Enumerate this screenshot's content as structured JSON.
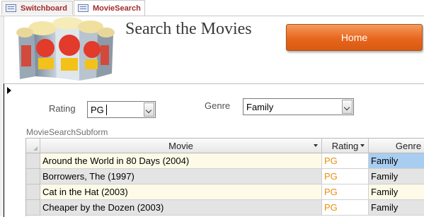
{
  "tabs": [
    {
      "label": "Switchboard",
      "active": false
    },
    {
      "label": "MovieSearch",
      "active": true
    }
  ],
  "form": {
    "title": "Search the Movies",
    "home_button": "Home",
    "rating_label": "Rating",
    "rating_value": "PG",
    "genre_label": "Genre",
    "genre_value": "Family",
    "subform_label": "MovieSearchSubform"
  },
  "table": {
    "columns": [
      "Movie",
      "Rating",
      "Genre"
    ],
    "rows": [
      {
        "movie": "Around the World in 80 Days (2004)",
        "rating": "PG",
        "genre": "Family"
      },
      {
        "movie": "Borrowers, The (1997)",
        "rating": "PG",
        "genre": "Family"
      },
      {
        "movie": "Cat in the Hat (2003)",
        "rating": "PG",
        "genre": "Family"
      },
      {
        "movie": "Cheaper by the Dozen (2003)",
        "rating": "PG",
        "genre": "Family"
      }
    ]
  },
  "colors": {
    "tab_text": "#a52a2a",
    "home_button": "#e7661d",
    "rating_text": "#e8900a",
    "selected_cell": "#a9cdf0"
  }
}
